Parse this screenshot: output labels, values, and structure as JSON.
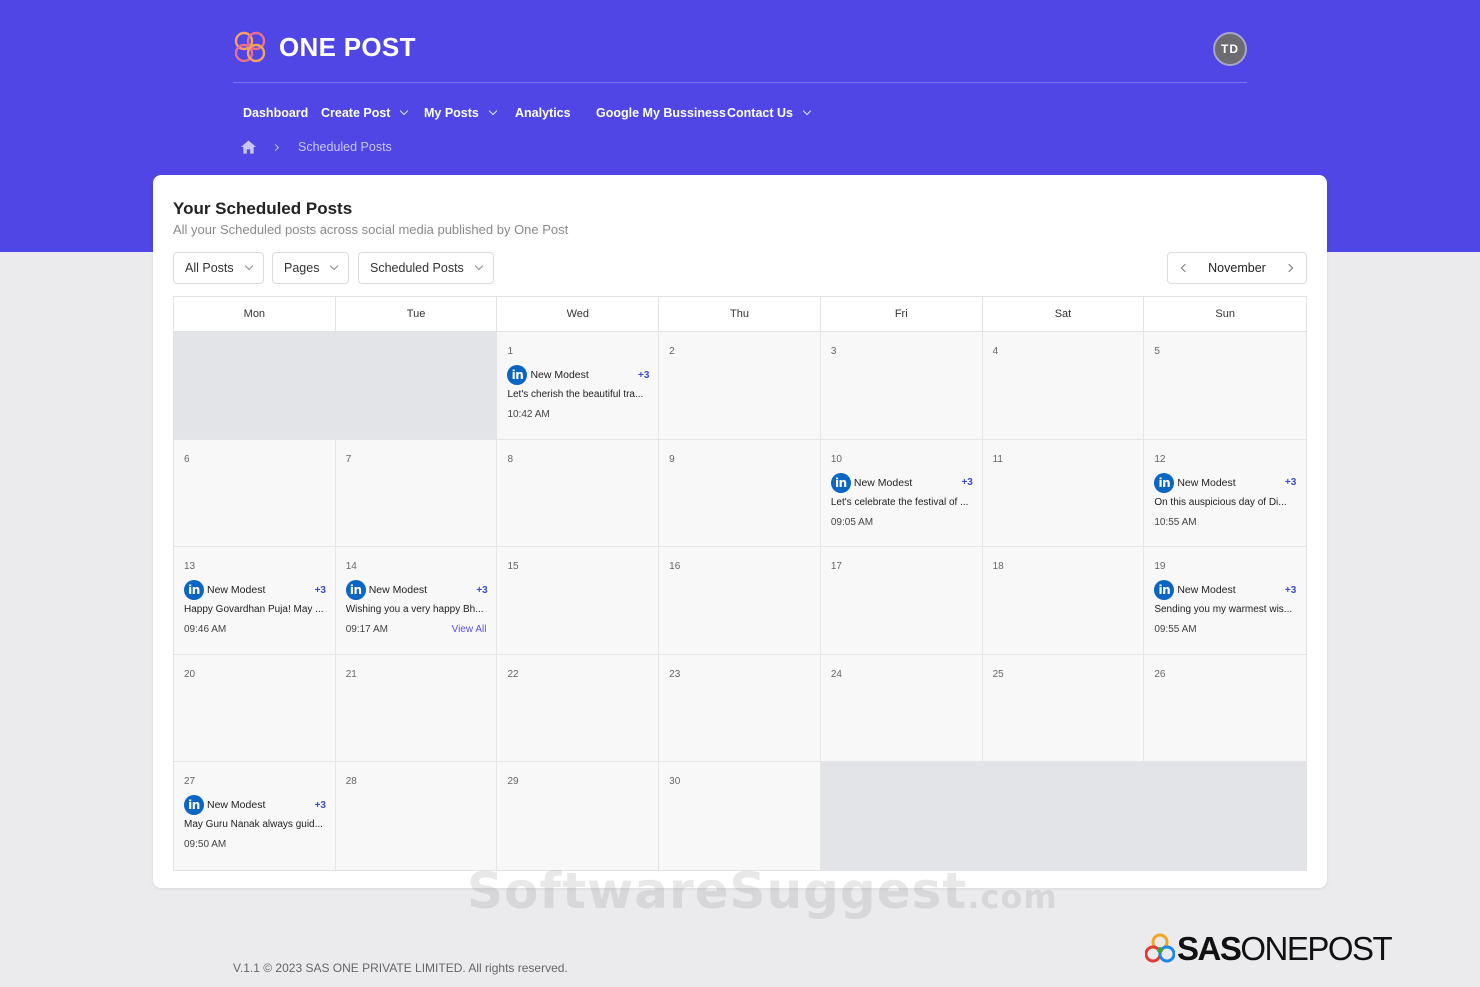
{
  "app": {
    "brand": "ONE POST",
    "avatar_initials": "TD",
    "accent": "#4f46e5"
  },
  "nav": [
    {
      "label": "Dashboard",
      "dropdown": false
    },
    {
      "label": "Create Post",
      "dropdown": true
    },
    {
      "label": "My Posts",
      "dropdown": true
    },
    {
      "label": "Analytics",
      "dropdown": false
    },
    {
      "label": "Google My Bussiness",
      "dropdown": false
    },
    {
      "label": "Contact Us",
      "dropdown": true
    }
  ],
  "breadcrumb": {
    "current": "Scheduled Posts"
  },
  "page": {
    "title": "Your Scheduled Posts",
    "subtitle": "All your Scheduled posts across social media published by One Post"
  },
  "filters": [
    {
      "label": "All Posts"
    },
    {
      "label": "Pages"
    },
    {
      "label": "Scheduled Posts"
    }
  ],
  "month": "November",
  "weekdays": [
    "Mon",
    "Tue",
    "Wed",
    "Thu",
    "Fri",
    "Sat",
    "Sun"
  ],
  "calendar": {
    "lead_empty": 2,
    "trail_empty": 3,
    "days": [
      {
        "n": "1",
        "post": {
          "account": "New Modest",
          "more": "+3",
          "text": "Let's cherish the beautiful tra...",
          "time": "10:42 AM"
        }
      },
      {
        "n": "2"
      },
      {
        "n": "3"
      },
      {
        "n": "4"
      },
      {
        "n": "5"
      },
      {
        "n": "6"
      },
      {
        "n": "7"
      },
      {
        "n": "8"
      },
      {
        "n": "9"
      },
      {
        "n": "10",
        "post": {
          "account": "New Modest",
          "more": "+3",
          "text": "Let's celebrate the festival of ...",
          "time": "09:05 AM"
        }
      },
      {
        "n": "11"
      },
      {
        "n": "12",
        "post": {
          "account": "New Modest",
          "more": "+3",
          "text": "On this auspicious day of Di...",
          "time": "10:55 AM"
        }
      },
      {
        "n": "13",
        "post": {
          "account": "New Modest",
          "more": "+3",
          "text": "Happy Govardhan Puja! May ...",
          "time": "09:46 AM"
        }
      },
      {
        "n": "14",
        "post": {
          "account": "New Modest",
          "more": "+3",
          "text": "Wishing you a very happy Bh...",
          "time": "09:17 AM",
          "view_all": "View All"
        }
      },
      {
        "n": "15"
      },
      {
        "n": "16"
      },
      {
        "n": "17"
      },
      {
        "n": "18"
      },
      {
        "n": "19",
        "post": {
          "account": "New Modest",
          "more": "+3",
          "text": "Sending you my warmest wis...",
          "time": "09:55 AM"
        }
      },
      {
        "n": "20"
      },
      {
        "n": "21"
      },
      {
        "n": "22"
      },
      {
        "n": "23"
      },
      {
        "n": "24"
      },
      {
        "n": "25"
      },
      {
        "n": "26"
      },
      {
        "n": "27",
        "post": {
          "account": "New Modest",
          "more": "+3",
          "text": "May Guru Nanak always guid...",
          "time": "09:50 AM"
        }
      },
      {
        "n": "28"
      },
      {
        "n": "29"
      },
      {
        "n": "30"
      }
    ]
  },
  "footer": {
    "text": "V.1.1 © 2023 SAS ONE PRIVATE LIMITED. All rights reserved."
  },
  "watermark": {
    "main": "SoftwareSuggest",
    "suffix": ".com"
  },
  "corner_logo": {
    "bold": "SAS",
    "light": "ONEPOST"
  }
}
